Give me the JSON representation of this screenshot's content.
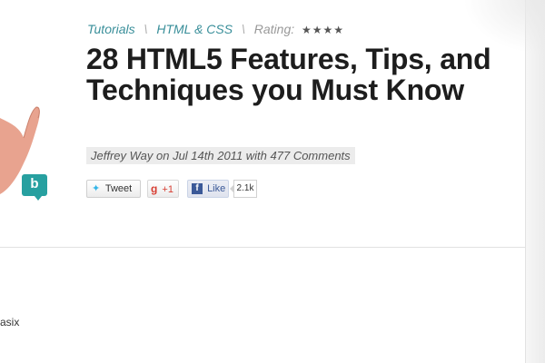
{
  "breadcrumb": {
    "category": "Tutorials",
    "subcategory": "HTML & CSS",
    "separator": "\\",
    "rating_label": "Rating:",
    "rating_stars": 4
  },
  "article": {
    "title": "28 HTML5 Features, Tips, and Techniques you Must Know",
    "meta": "Jeffrey Way on Jul 14th 2011 with 477 Comments"
  },
  "social": {
    "tweet_label": "Tweet",
    "gplus_label": "+1",
    "like_label": "Like",
    "like_count": "2.1k"
  },
  "badge": {
    "letter": "b"
  },
  "sidebar_snippet": "asix",
  "colors": {
    "link": "#3a8f9a",
    "title": "#1d1d1d",
    "badge": "#27a0a0",
    "facebook": "#3b5998",
    "gplus": "#d73d32",
    "twitter": "#33b5e8"
  }
}
